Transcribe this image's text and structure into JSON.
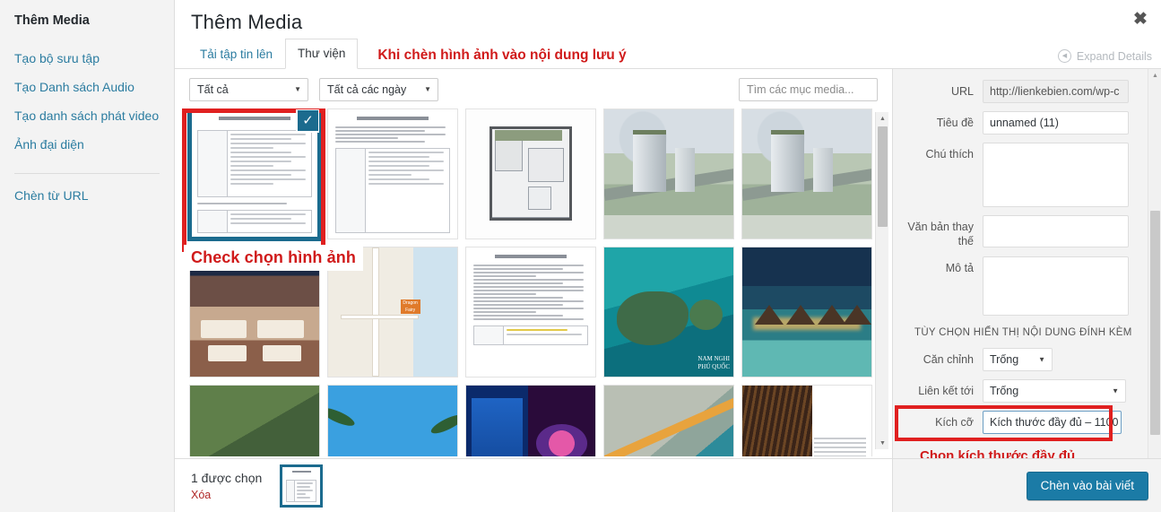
{
  "sidebar": {
    "title": "Thêm Media",
    "items": [
      {
        "label": "Tạo bộ sưu tập"
      },
      {
        "label": "Tạo Danh sách Audio"
      },
      {
        "label": "Tạo danh sách phát video"
      },
      {
        "label": "Ảnh đại diện"
      }
    ],
    "items2": [
      {
        "label": "Chèn từ URL"
      }
    ]
  },
  "frame": {
    "title": "Thêm Media",
    "close_icon": "close-icon",
    "tabs": [
      {
        "label": "Tải tập tin lên",
        "active": false
      },
      {
        "label": "Thư viện",
        "active": true
      }
    ],
    "annotation_top": "Khi chèn hình ảnh vào nội dung lưu ý",
    "expand_details": "Expand Details"
  },
  "toolbar": {
    "type_filter": "Tất cả",
    "date_filter": "Tất cả các ngày",
    "search_placeholder": "Tìm các mục media..."
  },
  "grid": {
    "annotation_select": "Check chọn hình ảnh",
    "selected_index": 0,
    "items": [
      {
        "name": "document-contract-1",
        "kind": "doc",
        "selected": true
      },
      {
        "name": "document-notice-2",
        "kind": "doc",
        "selected": false
      },
      {
        "name": "floor-plan",
        "kind": "plan",
        "selected": false
      },
      {
        "name": "building-render-aerial-1",
        "kind": "city",
        "selected": false
      },
      {
        "name": "building-render-aerial-2",
        "kind": "city",
        "selected": false
      },
      {
        "name": "restaurant-interior",
        "kind": "rest",
        "selected": false
      },
      {
        "name": "location-map",
        "kind": "map",
        "selected": false,
        "pin_label": "Dragon Fairy"
      },
      {
        "name": "document-report-3",
        "kind": "doc",
        "selected": false
      },
      {
        "name": "sea-aerial-nam-nghi",
        "kind": "sea",
        "selected": false,
        "caption": "NAM NGHI PHÚ QUỐC"
      },
      {
        "name": "resort-pool-night",
        "kind": "resort",
        "selected": false
      },
      {
        "name": "green-hillside",
        "kind": "green",
        "selected": false
      },
      {
        "name": "palm-trees-sky",
        "kind": "palm",
        "selected": false
      },
      {
        "name": "city-night-tower",
        "kind": "nightcity",
        "selected": false
      },
      {
        "name": "aerial-coast-road",
        "kind": "aerial",
        "selected": false
      },
      {
        "name": "wine-cellar",
        "kind": "wine",
        "selected": false
      }
    ]
  },
  "details": {
    "url_label": "URL",
    "url_value": "http://lienkebien.com/wp-c",
    "title_label": "Tiêu đề",
    "title_value": "unnamed (11)",
    "caption_label": "Chú thích",
    "caption_value": "",
    "alt_label": "Văn bản thay thế",
    "alt_value": "",
    "desc_label": "Mô tả",
    "desc_value": ""
  },
  "display_settings": {
    "section_title": "TÙY CHỌN HIỂN THỊ NỘI DUNG ĐÍNH KÈM",
    "align_label": "Căn chỉnh",
    "align_value": "Trống",
    "link_label": "Liên kết tới",
    "link_value": "Trống",
    "size_label": "Kích cỡ",
    "size_value": "Kích thước đầy đủ – 1100",
    "annotation_size": "Chọn kích thước đầy đủ"
  },
  "footer": {
    "selected_count": "1 được chọn",
    "clear_label": "Xóa",
    "insert_button": "Chèn vào bài viết"
  },
  "colors": {
    "accent": "#1b7ba6",
    "link": "#2b7ca0",
    "annotation_red": "#d01a1a",
    "highlight_red": "#e02020",
    "selection_teal": "#1b6b8e"
  }
}
